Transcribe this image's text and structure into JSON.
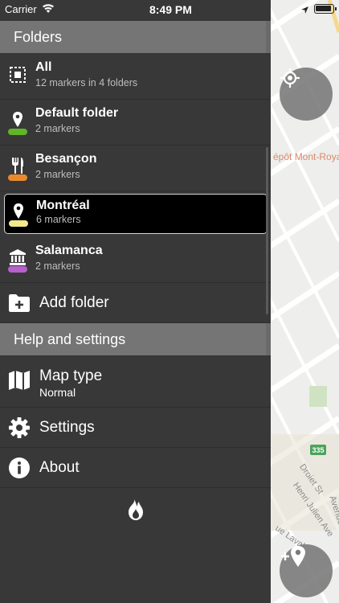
{
  "status_bar": {
    "carrier": "Carrier",
    "time": "8:49 PM"
  },
  "map": {
    "poi_label": "épôt Mont-Roya",
    "route_number": "335",
    "streets": [
      "Droiet St",
      "Henri Julien Ave",
      "Avenue du",
      "ue Laval"
    ]
  },
  "sections": {
    "folders": "Folders",
    "help": "Help and settings"
  },
  "folders": [
    {
      "title": "All",
      "subtitle": "12 markers in 4 folders",
      "icon": "select-all-icon",
      "color": ""
    },
    {
      "title": "Default folder",
      "subtitle": "2 markers",
      "icon": "map-pin-icon",
      "color": "#63b528"
    },
    {
      "title": "Besançon",
      "subtitle": "2 markers",
      "icon": "fork-knife-icon",
      "color": "#e88a2c"
    },
    {
      "title": "Montréal",
      "subtitle": "6 markers",
      "icon": "map-pin-icon",
      "color": "#f2ea8c"
    },
    {
      "title": "Salamanca",
      "subtitle": "2 markers",
      "icon": "museum-icon",
      "color": "#b660c9"
    }
  ],
  "actions": {
    "add_folder": "Add folder"
  },
  "settings": {
    "map_type": {
      "title": "Map type",
      "value": "Normal"
    },
    "settings": "Settings",
    "about": "About"
  }
}
